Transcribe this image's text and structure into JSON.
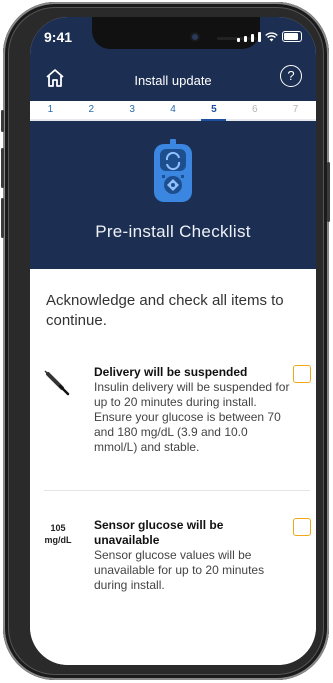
{
  "status_bar": {
    "time": "9:41"
  },
  "header": {
    "title": "Install update"
  },
  "steps": [
    "1",
    "2",
    "3",
    "4",
    "5",
    "6",
    "7"
  ],
  "active_step": 5,
  "hero": {
    "title": "Pre-install Checklist"
  },
  "intro": "Acknowledge and check all items to continue.",
  "items": [
    {
      "title": "Delivery will be suspended",
      "text": "Insulin delivery will be suspended for up to 20 minutes during install. Ensure your glucose is between 70 and 180 mg/dL (3.9 and 10.0 mmol/L) and stable."
    },
    {
      "value": "105",
      "unit": "mg/dL",
      "title": "Sensor glucose will be unavailable",
      "text": "Sensor glucose values will be unavailable for up to 20 minutes during install."
    }
  ],
  "colors": {
    "navy": "#1c2e52",
    "checkbox": "#f0a81a",
    "device_blue": "#3a86e0"
  }
}
